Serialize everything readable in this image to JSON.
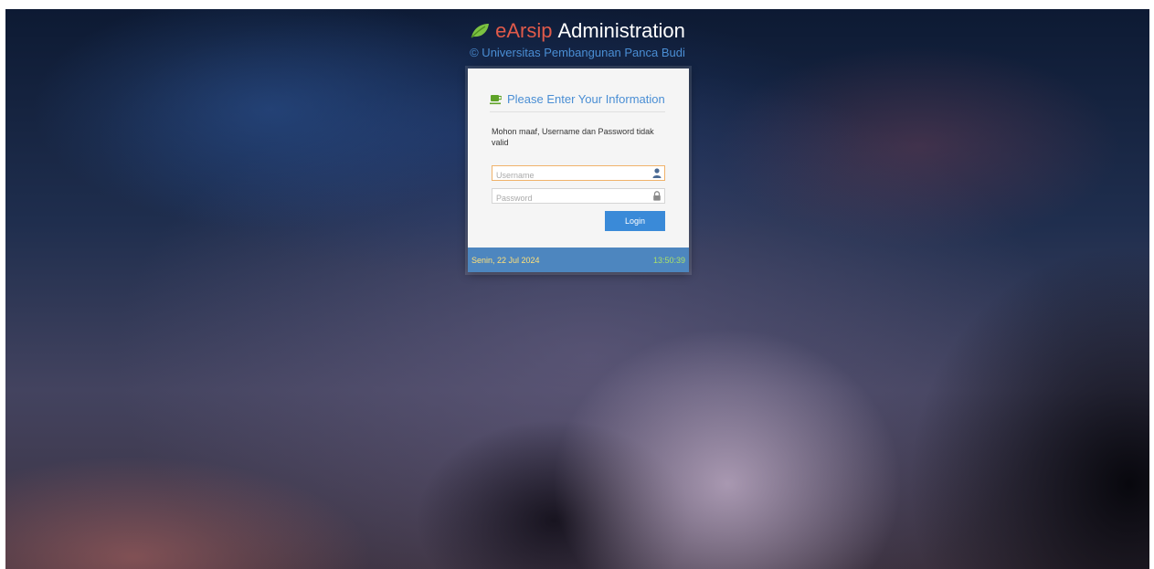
{
  "brand": {
    "title_accent": "eArsip",
    "title_rest": "Administration",
    "subtitle": "© Universitas Pembangunan Panca Budi",
    "icon": "leaf-icon"
  },
  "login": {
    "heading": "Please Enter Your Information",
    "heading_icon": "coffee-cup-icon",
    "error_message": "Mohon maaf, Username dan Password tidak valid",
    "username": {
      "value": "",
      "placeholder": "Username",
      "icon": "user-icon"
    },
    "password": {
      "value": "",
      "placeholder": "Password",
      "icon": "lock-icon"
    },
    "submit_label": "Login"
  },
  "footer": {
    "date": "Senin, 22 Jul 2024",
    "time": "13:50:39"
  },
  "colors": {
    "accent_blue": "#3a8ad8",
    "brand_red": "#e05a4a",
    "leaf_green": "#7cc242",
    "footer_bar": "#4d86bf",
    "date_yellow": "#ffe17a",
    "time_green": "#a9e06a"
  }
}
